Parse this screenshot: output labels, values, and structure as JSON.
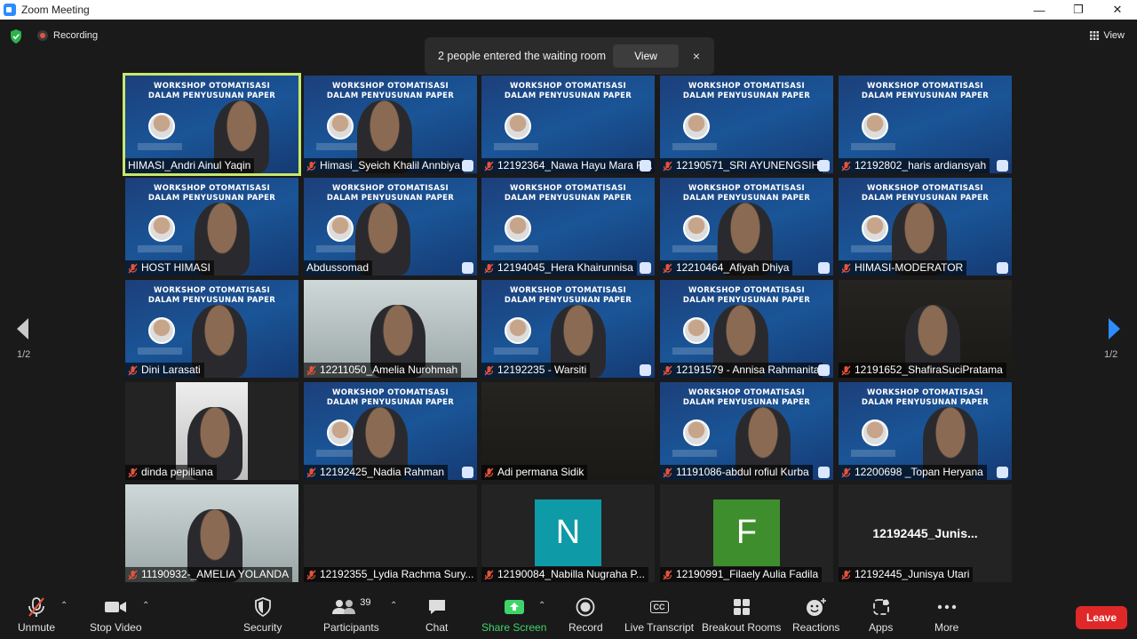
{
  "window": {
    "title": "Zoom Meeting"
  },
  "topbar": {
    "recording_label": "Recording",
    "view_label": "View"
  },
  "notification": {
    "message": "2 people entered the waiting room",
    "view_button": "View",
    "close": "×"
  },
  "slide_banner": {
    "line1": "WORKSHOP OTOMATISASI",
    "line2": "DALAM PENYUSUNAN PAPER"
  },
  "pagination": {
    "left": "1/2",
    "right": "1/2"
  },
  "participants": [
    {
      "name": "HIMASI_Andri Ainul Yaqin",
      "muted": false,
      "active": true
    },
    {
      "name": "Himasi_Syeich Khalil Annbiya",
      "muted": true
    },
    {
      "name": "12192364_Nawa Hayu Mara R...",
      "muted": true
    },
    {
      "name": "12190571_SRI AYUNENGSIH",
      "muted": true
    },
    {
      "name": "12192802_haris ardiansyah",
      "muted": true
    },
    {
      "name": "HOST HIMASI",
      "muted": true
    },
    {
      "name": "Abdussomad",
      "muted": false
    },
    {
      "name": "12194045_Hera Khairunnisa",
      "muted": true
    },
    {
      "name": "12210464_Afiyah Dhiya",
      "muted": true
    },
    {
      "name": "HIMASI-MODERATOR",
      "muted": true
    },
    {
      "name": "Dini Larasati",
      "muted": true
    },
    {
      "name": "12211050_Amelia Nurohmah",
      "muted": true
    },
    {
      "name": "12192235 - Warsiti",
      "muted": true
    },
    {
      "name": "12191579 - Annisa Rahmanita",
      "muted": true
    },
    {
      "name": "12191652_ShafiraSuciPratama",
      "muted": true
    },
    {
      "name": "dinda pepiliana",
      "muted": true
    },
    {
      "name": "12192425_Nadia Rahman",
      "muted": true
    },
    {
      "name": "Adi permana Sidik",
      "muted": true
    },
    {
      "name": "11191086-abdul rofiul Kurba",
      "muted": true
    },
    {
      "name": "12200698 _Topan Heryana",
      "muted": true
    },
    {
      "name": "11190932-_AMELIA YOLANDA",
      "muted": true
    },
    {
      "name": "12192355_Lydia Rachma Sury...",
      "muted": true
    },
    {
      "name": "12190084_Nabilla Nugraha P...",
      "muted": true,
      "avatar_letter": "N",
      "avatar_color": "#0e9aa7"
    },
    {
      "name": "12190991_Filaely Aulia Fadila",
      "muted": true,
      "avatar_letter": "F",
      "avatar_color": "#3e8e2e"
    },
    {
      "name": "12192445_Junisya Utari",
      "muted": true,
      "display_name": "12192445_Junis..."
    }
  ],
  "toolbar": {
    "unmute": "Unmute",
    "stop_video": "Stop Video",
    "security": "Security",
    "participants": "Participants",
    "participant_count": "39",
    "chat": "Chat",
    "share_screen": "Share Screen",
    "record": "Record",
    "live_transcript": "Live Transcript",
    "breakout_rooms": "Breakout Rooms",
    "reactions": "Reactions",
    "apps": "Apps",
    "more": "More",
    "leave": "Leave",
    "cc": "CC"
  },
  "colors": {
    "active_speaker": "#c8e86a",
    "leave": "#e02828",
    "share": "#3fd46a",
    "mute": "#e5533c"
  }
}
